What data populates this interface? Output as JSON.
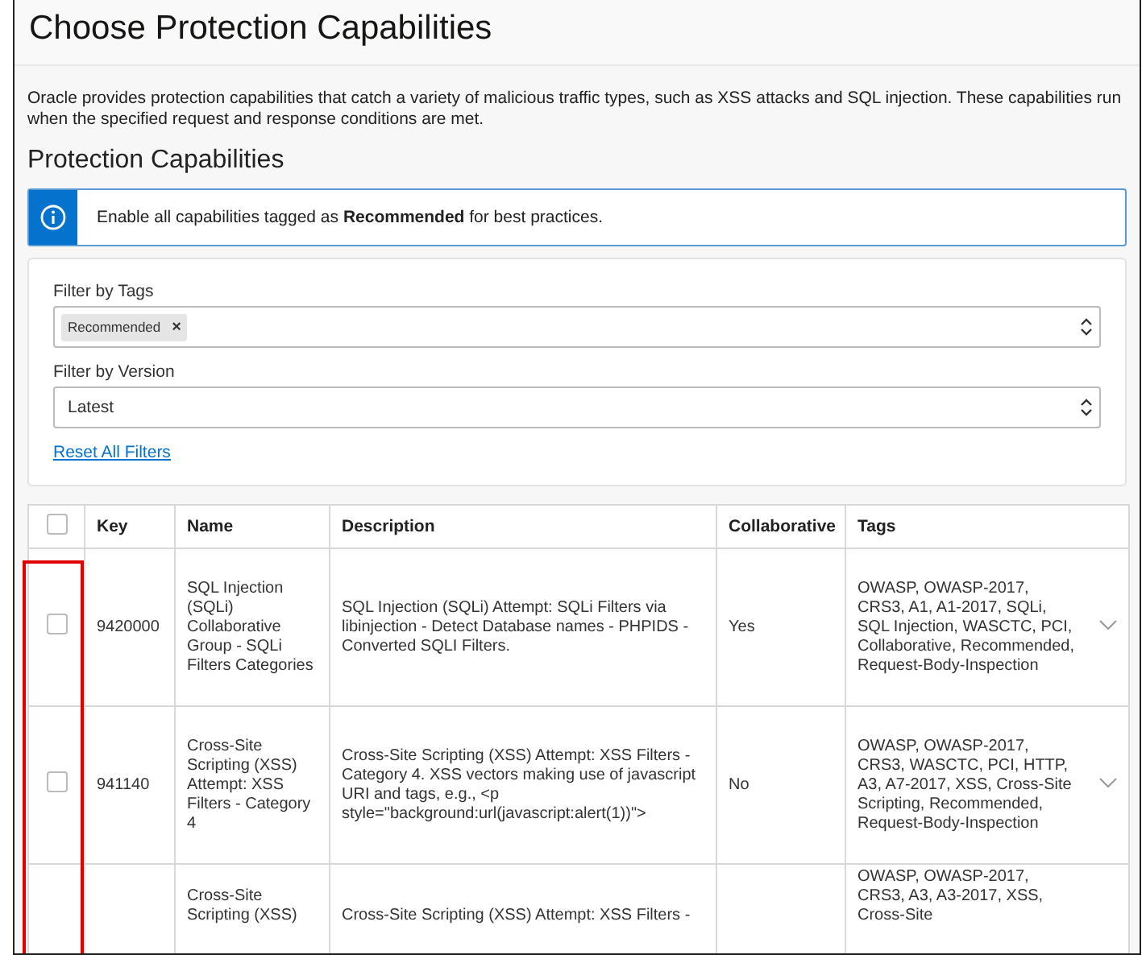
{
  "title": "Choose Protection Capabilities",
  "intro": "Oracle provides protection capabilities that catch a variety of malicious traffic types, such as XSS attacks and SQL injection. These capabilities run when the specified request and response conditions are met.",
  "section_title": "Protection Capabilities",
  "banner": {
    "text": "Enable all capabilities tagged as **Recommended** for best practices."
  },
  "filters": {
    "tags": {
      "label": "Filter by Tags",
      "chips": [
        {
          "label": "Recommended",
          "remove": "×"
        }
      ]
    },
    "version": {
      "label": "Filter by Version",
      "value": "Latest"
    },
    "reset_link": "Reset All Filters"
  },
  "table": {
    "select_all": {
      "checked": false
    },
    "columns": [
      "Key",
      "Name",
      "Description",
      "Collaborative",
      "Tags"
    ],
    "rows": [
      {
        "checked": false,
        "key": "9420000",
        "name": "SQL Injection (SQLi) Collaborative Group - SQLi Filters Categories",
        "description": "SQL Injection (SQLi) Attempt: SQLi Filters via libinjection - Detect Database names - PHPIDS - Converted SQLI Filters.",
        "collaborative": "Yes",
        "tags": "OWASP, OWASP-2017, CRS3, A1, A1-2017, SQLi, SQL Injection, WASCTC, PCI, Collaborative, Recommended, Request-Body-Inspection"
      },
      {
        "checked": false,
        "key": "941140",
        "name": "Cross-Site Scripting (XSS) Attempt: XSS Filters - Category 4",
        "description": "Cross-Site Scripting (XSS) Attempt: XSS Filters - Category 4. XSS vectors making use of javascript URI and tags, e.g., <p style=\"background:url(javascript:alert(1))\">",
        "collaborative": "No",
        "tags": "OWASP, OWASP-2017, CRS3, WASCTC, PCI, HTTP, A3, A7-2017, XSS, Cross-Site Scripting, Recommended, Request-Body-Inspection"
      },
      {
        "partial": true,
        "name": "Cross-Site Scripting (XSS)",
        "description": "Cross-Site Scripting (XSS) Attempt: XSS Filters -",
        "tags": "OWASP, OWASP-2017, CRS3, A3, A3-2017, XSS, Cross-Site"
      }
    ]
  }
}
